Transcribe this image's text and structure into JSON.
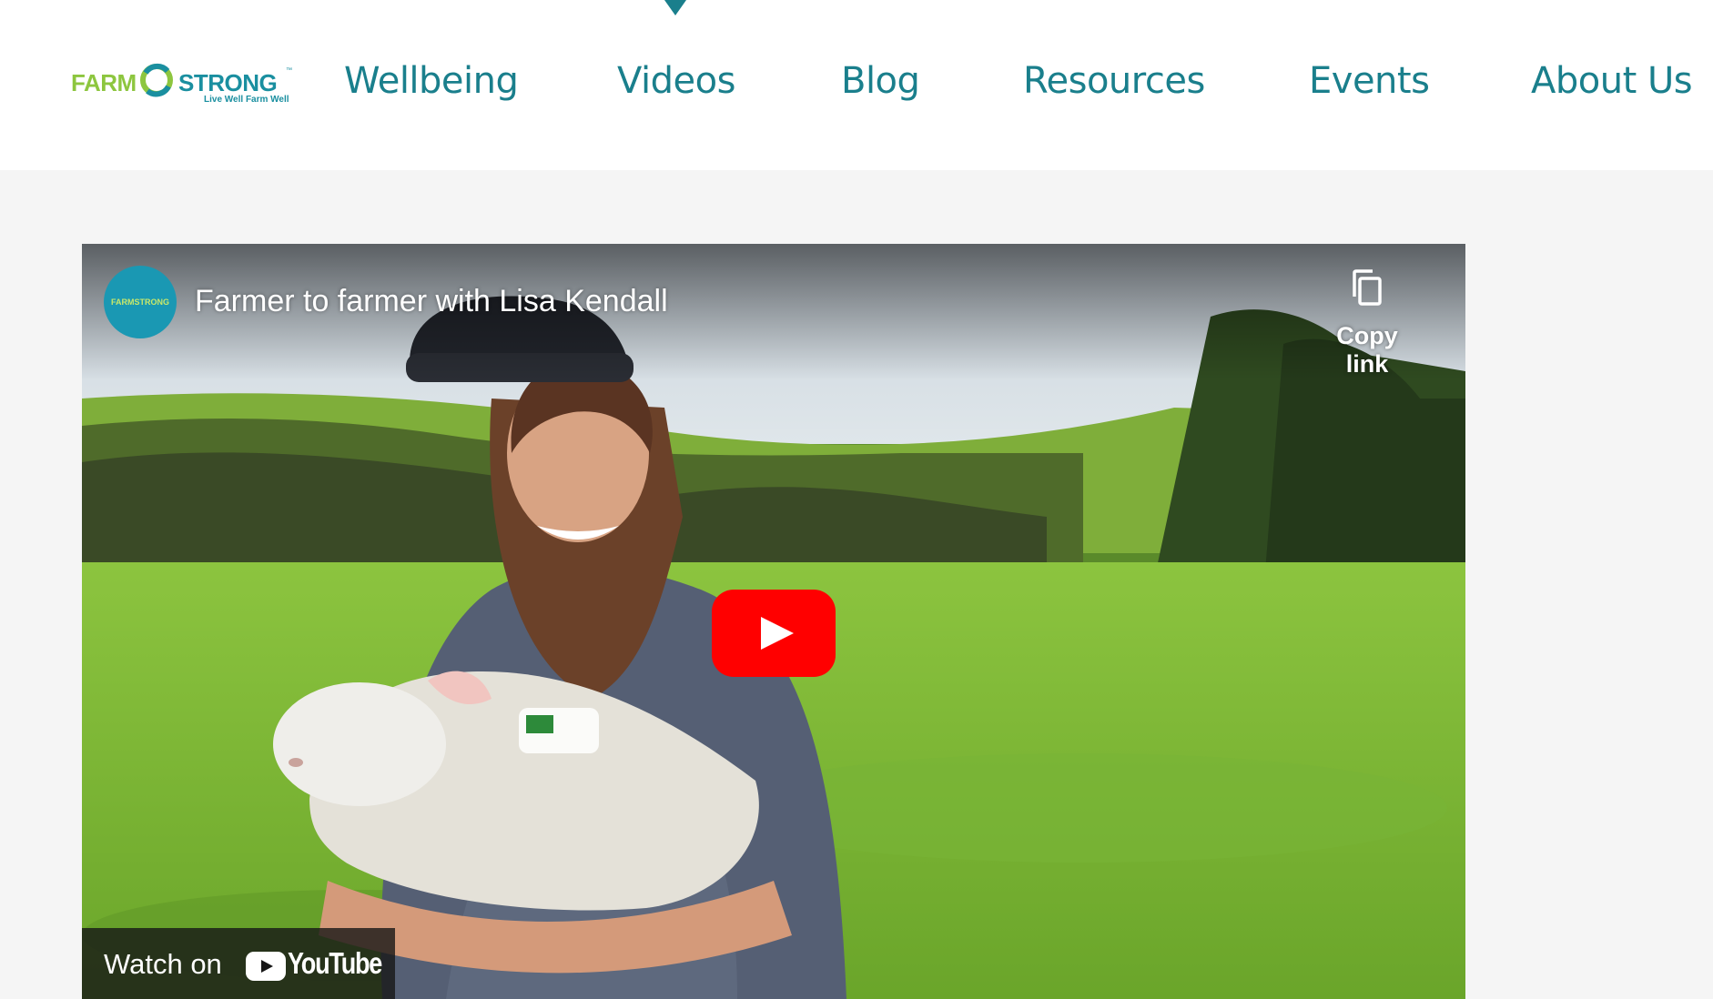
{
  "brand": {
    "logo_word_left": "FARM",
    "logo_word_right": "STRONG",
    "tagline": "Live Well Farm Well",
    "trademark": "™",
    "icon": "farmstrong-ring-logo",
    "colors": {
      "green": "#8dc63f",
      "teal": "#1a8fa0"
    }
  },
  "nav": {
    "active_item": "Videos",
    "active_indicator_color": "#1a7f8c",
    "items": [
      {
        "label": "Wellbeing"
      },
      {
        "label": "Videos"
      },
      {
        "label": "Blog"
      },
      {
        "label": "Resources"
      },
      {
        "label": "Events"
      },
      {
        "label": "About Us"
      }
    ]
  },
  "video": {
    "title": "Farmer to farmer with Lisa Kendall",
    "channel_avatar_text": "FARMSTRONG",
    "copy_link_label": "Copy link",
    "copy_icon": "copy-icon",
    "play_icon": "youtube-play-icon",
    "watch_on_label": "Watch on",
    "youtube_wordmark": "YouTube",
    "colors": {
      "play_red": "#ff0000"
    }
  }
}
